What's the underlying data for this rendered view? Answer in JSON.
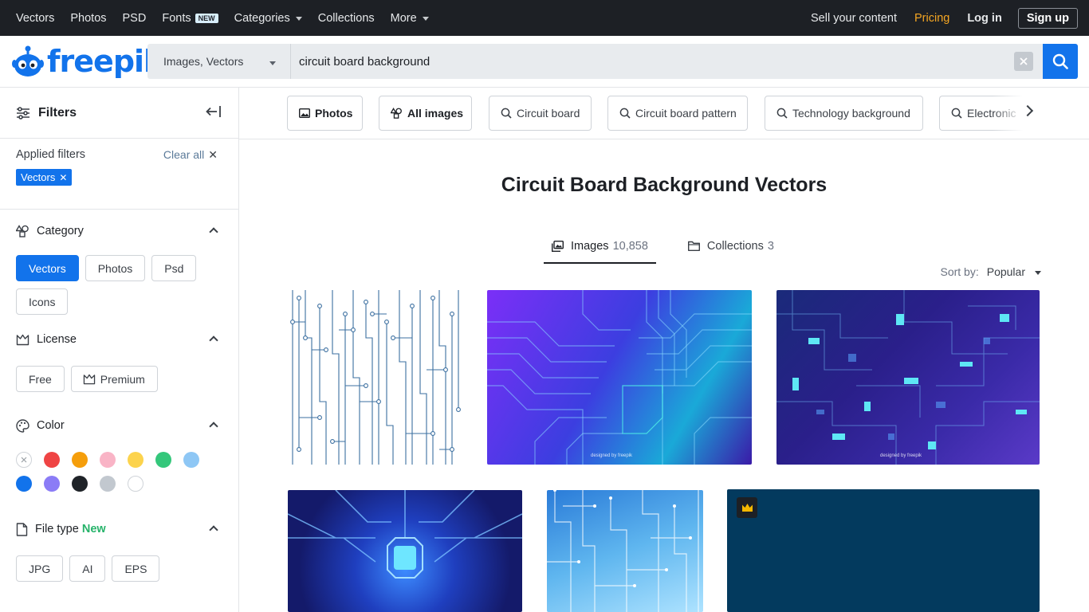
{
  "topnav": {
    "items": [
      "Vectors",
      "Photos",
      "PSD",
      "Fonts",
      "Categories",
      "Collections",
      "More"
    ],
    "fonts_badge": "NEW",
    "sell": "Sell your content",
    "pricing": "Pricing",
    "login": "Log in",
    "signup": "Sign up"
  },
  "header": {
    "logo": "freepik",
    "search_type": "Images, Vectors",
    "search_value": "circuit board background"
  },
  "sidebar": {
    "title": "Filters",
    "applied_label": "Applied filters",
    "clear_all": "Clear all",
    "applied_chip": "Vectors",
    "category": {
      "title": "Category",
      "options": [
        "Vectors",
        "Photos",
        "Psd",
        "Icons"
      ]
    },
    "license": {
      "title": "License",
      "options": [
        "Free",
        "Premium"
      ]
    },
    "color": {
      "title": "Color",
      "swatches": [
        "none",
        "#ef4444",
        "#f59e0b",
        "#f9b4c6",
        "#fcd34d",
        "#34c77b",
        "#8ec7f5",
        "#1273eb",
        "#8b7cf6",
        "#1f2328",
        "#c2c8cf",
        "#ffffff"
      ]
    },
    "filetype": {
      "title": "File type",
      "new": "New",
      "options": [
        "JPG",
        "AI",
        "EPS"
      ]
    }
  },
  "tags": [
    "Photos",
    "All images",
    "Circuit board",
    "Circuit board pattern",
    "Technology background",
    "Electronic"
  ],
  "main": {
    "title": "Circuit Board Background Vectors",
    "tab_images": "Images",
    "tab_images_count": "10,858",
    "tab_collections": "Collections",
    "tab_collections_count": "3",
    "sort_label": "Sort by:",
    "sort_value": "Popular"
  },
  "thumbs": {
    "watermark": "designed by freepik"
  },
  "colors": {
    "brand": "#1273eb",
    "topbar": "#1d2025",
    "pricing": "#f5a623",
    "new_green": "#26b36a"
  }
}
